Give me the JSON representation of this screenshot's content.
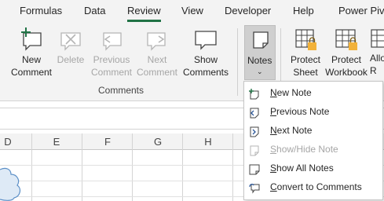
{
  "tabs": [
    {
      "label": "Formulas"
    },
    {
      "label": "Data"
    },
    {
      "label": "Review",
      "active": true
    },
    {
      "label": "View"
    },
    {
      "label": "Developer"
    },
    {
      "label": "Help"
    },
    {
      "label": "Power Pivot"
    }
  ],
  "ribbon": {
    "new_comment": {
      "line1": "New",
      "line2": "Comment"
    },
    "delete": {
      "line1": "Delete"
    },
    "previous_comment": {
      "line1": "Previous",
      "line2": "Comment"
    },
    "next_comment": {
      "line1": "Next",
      "line2": "Comment"
    },
    "show_comments": {
      "line1": "Show",
      "line2": "Comments"
    },
    "comments_group": "Comments",
    "notes": {
      "label": "Notes"
    },
    "protect_sheet": {
      "line1": "Protect",
      "line2": "Sheet"
    },
    "protect_workbook": {
      "line1": "Protect",
      "line2": "Workbook"
    },
    "allow_ranges": {
      "line1": "Allo",
      "line2": "R"
    }
  },
  "columns": [
    "D",
    "E",
    "F",
    "G",
    "H"
  ],
  "notes_menu": {
    "items": [
      {
        "label": "New Note",
        "icon": "new-note-icon",
        "enabled": true
      },
      {
        "label": "Previous Note",
        "icon": "previous-note-icon",
        "enabled": true
      },
      {
        "label": "Next Note",
        "icon": "next-note-icon",
        "enabled": true
      },
      {
        "label": "Show/Hide Note",
        "icon": "show-hide-note-icon",
        "enabled": false
      },
      {
        "label": "Show All Notes",
        "icon": "show-all-notes-icon",
        "enabled": true
      },
      {
        "label": "Convert to Comments",
        "icon": "convert-to-comments-icon",
        "enabled": true
      }
    ]
  },
  "colors": {
    "accent": "#217346",
    "disabled": "#a6a6a6",
    "lock": "#f2b23a"
  }
}
